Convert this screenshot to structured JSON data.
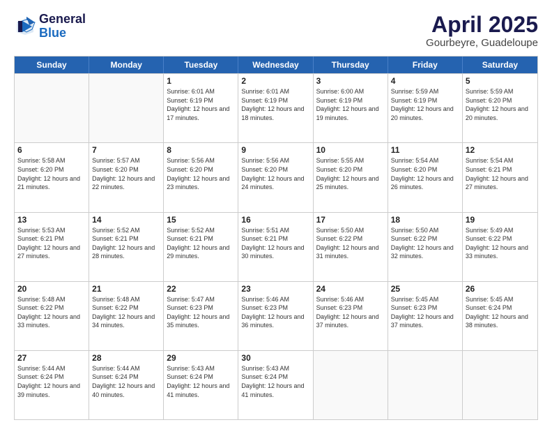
{
  "logo": {
    "general": "General",
    "blue": "Blue"
  },
  "title": "April 2025",
  "subtitle": "Gourbeyre, Guadeloupe",
  "days": [
    "Sunday",
    "Monday",
    "Tuesday",
    "Wednesday",
    "Thursday",
    "Friday",
    "Saturday"
  ],
  "weeks": [
    [
      {
        "day": "",
        "info": ""
      },
      {
        "day": "",
        "info": ""
      },
      {
        "day": "1",
        "info": "Sunrise: 6:01 AM\nSunset: 6:19 PM\nDaylight: 12 hours and 17 minutes."
      },
      {
        "day": "2",
        "info": "Sunrise: 6:01 AM\nSunset: 6:19 PM\nDaylight: 12 hours and 18 minutes."
      },
      {
        "day": "3",
        "info": "Sunrise: 6:00 AM\nSunset: 6:19 PM\nDaylight: 12 hours and 19 minutes."
      },
      {
        "day": "4",
        "info": "Sunrise: 5:59 AM\nSunset: 6:19 PM\nDaylight: 12 hours and 20 minutes."
      },
      {
        "day": "5",
        "info": "Sunrise: 5:59 AM\nSunset: 6:20 PM\nDaylight: 12 hours and 20 minutes."
      }
    ],
    [
      {
        "day": "6",
        "info": "Sunrise: 5:58 AM\nSunset: 6:20 PM\nDaylight: 12 hours and 21 minutes."
      },
      {
        "day": "7",
        "info": "Sunrise: 5:57 AM\nSunset: 6:20 PM\nDaylight: 12 hours and 22 minutes."
      },
      {
        "day": "8",
        "info": "Sunrise: 5:56 AM\nSunset: 6:20 PM\nDaylight: 12 hours and 23 minutes."
      },
      {
        "day": "9",
        "info": "Sunrise: 5:56 AM\nSunset: 6:20 PM\nDaylight: 12 hours and 24 minutes."
      },
      {
        "day": "10",
        "info": "Sunrise: 5:55 AM\nSunset: 6:20 PM\nDaylight: 12 hours and 25 minutes."
      },
      {
        "day": "11",
        "info": "Sunrise: 5:54 AM\nSunset: 6:20 PM\nDaylight: 12 hours and 26 minutes."
      },
      {
        "day": "12",
        "info": "Sunrise: 5:54 AM\nSunset: 6:21 PM\nDaylight: 12 hours and 27 minutes."
      }
    ],
    [
      {
        "day": "13",
        "info": "Sunrise: 5:53 AM\nSunset: 6:21 PM\nDaylight: 12 hours and 27 minutes."
      },
      {
        "day": "14",
        "info": "Sunrise: 5:52 AM\nSunset: 6:21 PM\nDaylight: 12 hours and 28 minutes."
      },
      {
        "day": "15",
        "info": "Sunrise: 5:52 AM\nSunset: 6:21 PM\nDaylight: 12 hours and 29 minutes."
      },
      {
        "day": "16",
        "info": "Sunrise: 5:51 AM\nSunset: 6:21 PM\nDaylight: 12 hours and 30 minutes."
      },
      {
        "day": "17",
        "info": "Sunrise: 5:50 AM\nSunset: 6:22 PM\nDaylight: 12 hours and 31 minutes."
      },
      {
        "day": "18",
        "info": "Sunrise: 5:50 AM\nSunset: 6:22 PM\nDaylight: 12 hours and 32 minutes."
      },
      {
        "day": "19",
        "info": "Sunrise: 5:49 AM\nSunset: 6:22 PM\nDaylight: 12 hours and 33 minutes."
      }
    ],
    [
      {
        "day": "20",
        "info": "Sunrise: 5:48 AM\nSunset: 6:22 PM\nDaylight: 12 hours and 33 minutes."
      },
      {
        "day": "21",
        "info": "Sunrise: 5:48 AM\nSunset: 6:22 PM\nDaylight: 12 hours and 34 minutes."
      },
      {
        "day": "22",
        "info": "Sunrise: 5:47 AM\nSunset: 6:23 PM\nDaylight: 12 hours and 35 minutes."
      },
      {
        "day": "23",
        "info": "Sunrise: 5:46 AM\nSunset: 6:23 PM\nDaylight: 12 hours and 36 minutes."
      },
      {
        "day": "24",
        "info": "Sunrise: 5:46 AM\nSunset: 6:23 PM\nDaylight: 12 hours and 37 minutes."
      },
      {
        "day": "25",
        "info": "Sunrise: 5:45 AM\nSunset: 6:23 PM\nDaylight: 12 hours and 37 minutes."
      },
      {
        "day": "26",
        "info": "Sunrise: 5:45 AM\nSunset: 6:24 PM\nDaylight: 12 hours and 38 minutes."
      }
    ],
    [
      {
        "day": "27",
        "info": "Sunrise: 5:44 AM\nSunset: 6:24 PM\nDaylight: 12 hours and 39 minutes."
      },
      {
        "day": "28",
        "info": "Sunrise: 5:44 AM\nSunset: 6:24 PM\nDaylight: 12 hours and 40 minutes."
      },
      {
        "day": "29",
        "info": "Sunrise: 5:43 AM\nSunset: 6:24 PM\nDaylight: 12 hours and 41 minutes."
      },
      {
        "day": "30",
        "info": "Sunrise: 5:43 AM\nSunset: 6:24 PM\nDaylight: 12 hours and 41 minutes."
      },
      {
        "day": "",
        "info": ""
      },
      {
        "day": "",
        "info": ""
      },
      {
        "day": "",
        "info": ""
      }
    ]
  ]
}
